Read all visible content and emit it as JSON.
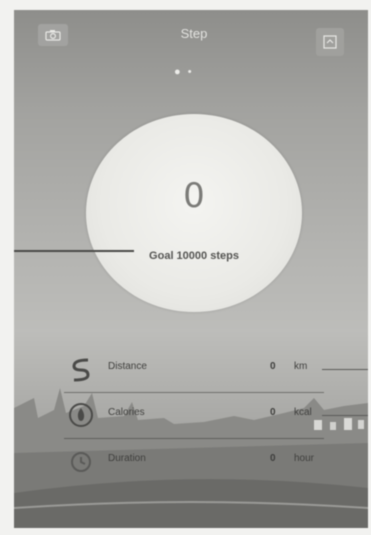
{
  "header": {
    "title": "Step",
    "left_icon": "camera-icon",
    "right_icon": "share-icon",
    "page_dots": "● •"
  },
  "step_circle": {
    "steps_value": "0",
    "goal_text": "Goal 10000 steps"
  },
  "stats": [
    {
      "icon": "distance-icon",
      "label": "Distance",
      "value": "0",
      "unit": "km"
    },
    {
      "icon": "calories-icon",
      "label": "Calories",
      "value": "0",
      "unit": "kcal"
    },
    {
      "icon": "duration-icon",
      "label": "Duration",
      "value": "0",
      "unit": "hour"
    }
  ]
}
